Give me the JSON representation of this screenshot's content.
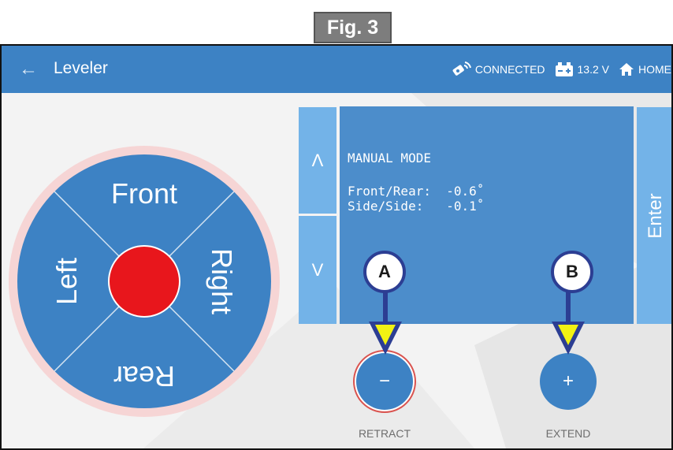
{
  "figure": {
    "label": "Fig. 3"
  },
  "app_bar": {
    "title": "Leveler",
    "status": {
      "connection": "CONNECTED",
      "voltage": "13.2 V",
      "home": "HOME"
    }
  },
  "dial": {
    "front_label": "Front",
    "rear_label": "Rear",
    "left_label": "Left",
    "right_label": "Right"
  },
  "controls": {
    "up_label": "Λ",
    "down_label": "V",
    "enter_label": "Enter"
  },
  "display": {
    "mode": "MANUAL MODE",
    "front_rear_label": "Front/Rear:",
    "front_rear_value": "-0.6˚",
    "side_side_label": "Side/Side:",
    "side_side_value": "-0.1˚"
  },
  "actions": {
    "retract_symbol": "−",
    "retract_label": "RETRACT",
    "extend_symbol": "+",
    "extend_label": "EXTEND"
  },
  "callouts": {
    "a": "A",
    "b": "B"
  },
  "colors": {
    "primary_blue": "#3d82c4",
    "light_blue": "#73b3e8",
    "display_blue": "#4c8dcb",
    "center_red": "#e8161c",
    "ring_pink": "#f6d5d5",
    "callout_navy": "#2c3e93",
    "arrow_yellow": "#f2f213"
  }
}
